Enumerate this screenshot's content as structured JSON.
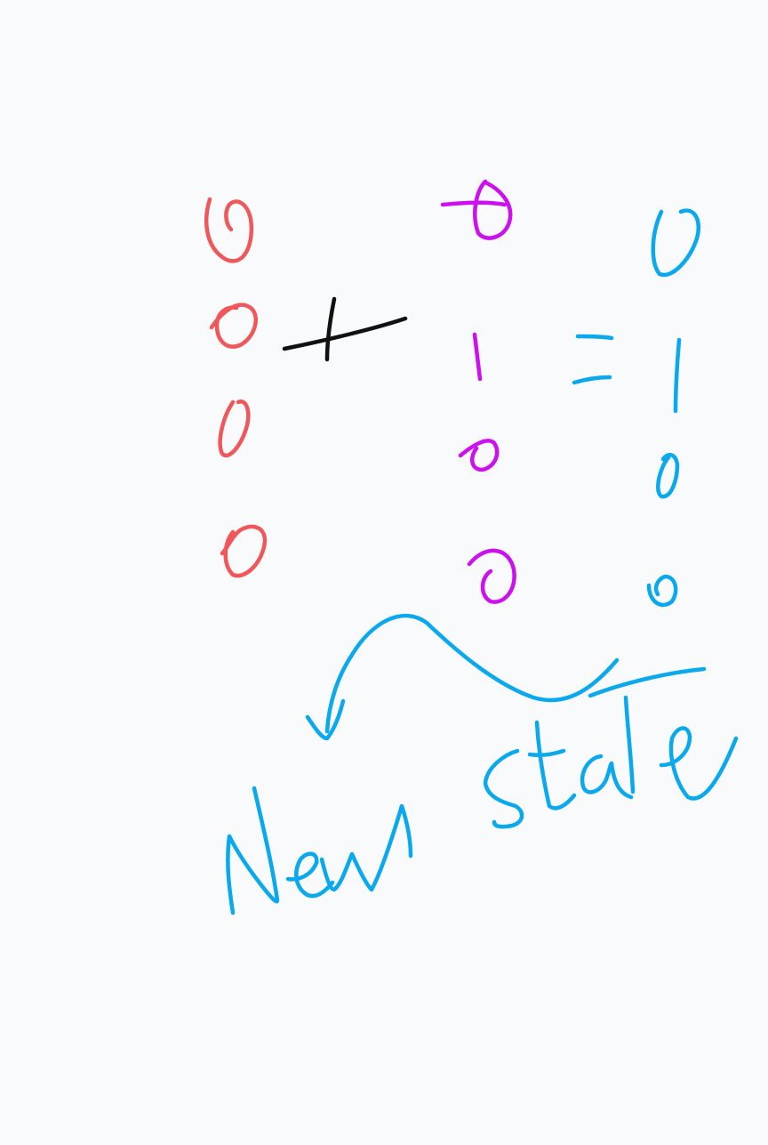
{
  "colors": {
    "background": "#f9fafb",
    "operand_a": "#f0575b",
    "operand_b": "#cc11ee",
    "result": "#0aa8ec",
    "operator": "#111111"
  },
  "operand_a": {
    "digits": [
      "0",
      "0",
      "0",
      "0"
    ]
  },
  "operator_plus": "+",
  "operand_b": {
    "digits": [
      "0",
      "1",
      "0",
      "0"
    ]
  },
  "operator_equals": "=",
  "result": {
    "digits": [
      "0",
      "1",
      "0",
      "0"
    ]
  },
  "arrow_icon": "curved-arrow-icon",
  "caption": "New state"
}
